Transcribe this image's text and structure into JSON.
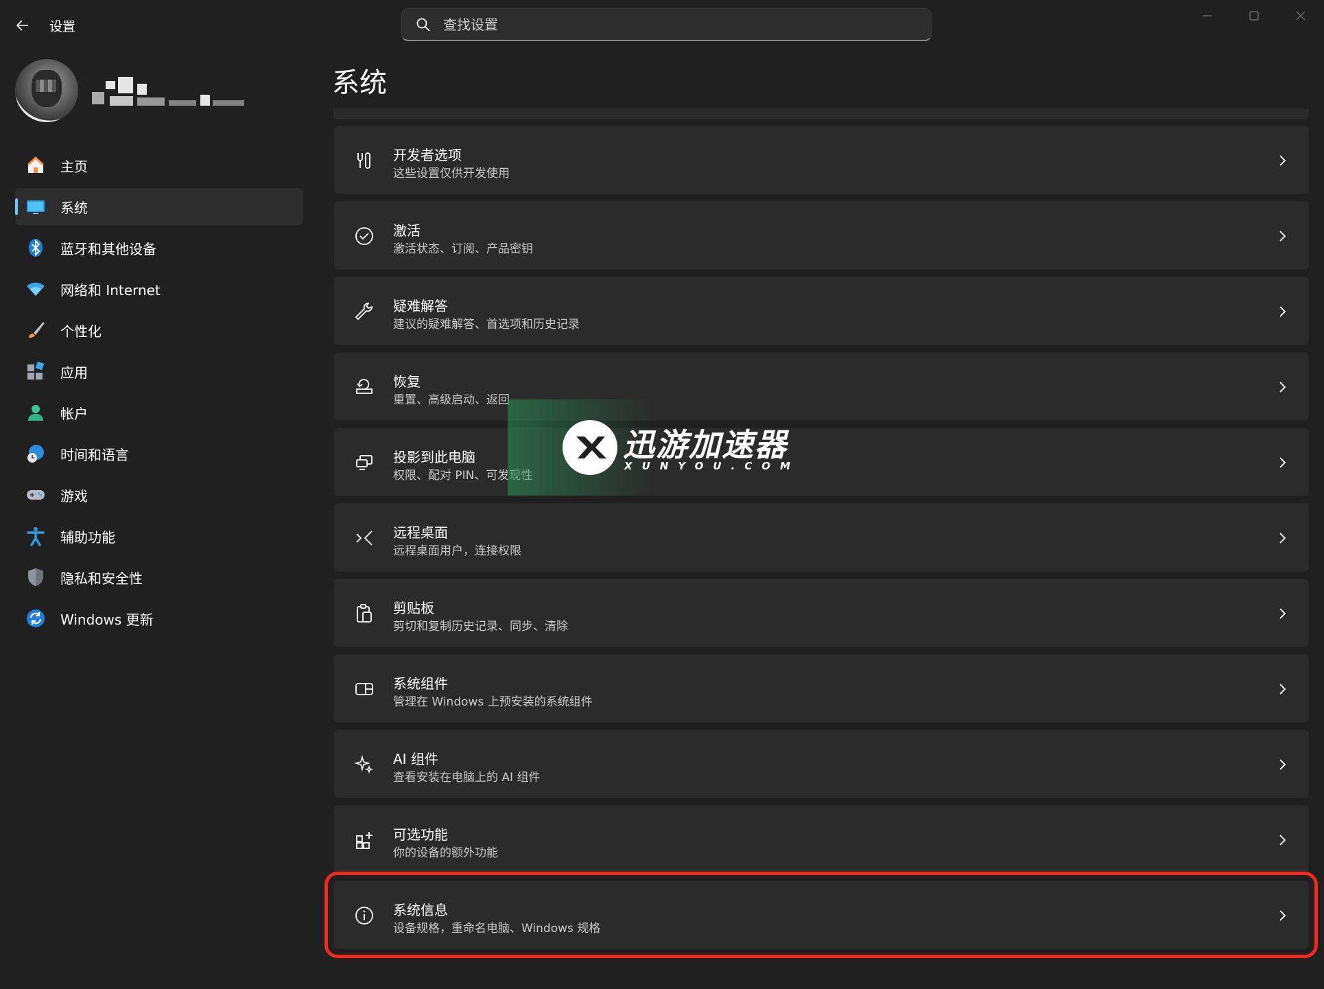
{
  "window": {
    "app_title": "设置",
    "search": {
      "placeholder": "查找设置"
    }
  },
  "sidebar": {
    "items": [
      {
        "label": "主页",
        "icon": "home-icon",
        "selected": false
      },
      {
        "label": "系统",
        "icon": "system-monitor-icon",
        "selected": true
      },
      {
        "label": "蓝牙和其他设备",
        "icon": "bluetooth-icon",
        "selected": false
      },
      {
        "label": "网络和 Internet",
        "icon": "wifi-icon",
        "selected": false
      },
      {
        "label": "个性化",
        "icon": "paintbrush-icon",
        "selected": false
      },
      {
        "label": "应用",
        "icon": "apps-icon",
        "selected": false
      },
      {
        "label": "帐户",
        "icon": "account-icon",
        "selected": false
      },
      {
        "label": "时间和语言",
        "icon": "time-language-icon",
        "selected": false
      },
      {
        "label": "游戏",
        "icon": "gamepad-icon",
        "selected": false
      },
      {
        "label": "辅助功能",
        "icon": "accessibility-icon",
        "selected": false
      },
      {
        "label": "隐私和安全性",
        "icon": "shield-icon",
        "selected": false
      },
      {
        "label": "Windows 更新",
        "icon": "windows-update-icon",
        "selected": false
      }
    ]
  },
  "main": {
    "page_title": "系统",
    "cards": [
      {
        "title": "开发者选项",
        "subtitle": "这些设置仅供开发使用",
        "icon": "developer-tools-icon"
      },
      {
        "title": "激活",
        "subtitle": "激活状态、订阅、产品密钥",
        "icon": "check-circle-icon"
      },
      {
        "title": "疑难解答",
        "subtitle": "建议的疑难解答、首选项和历史记录",
        "icon": "wrench-icon"
      },
      {
        "title": "恢复",
        "subtitle": "重置、高级启动、返回",
        "icon": "recovery-icon"
      },
      {
        "title": "投影到此电脑",
        "subtitle": "权限、配对 PIN、可发现性",
        "icon": "project-to-pc-icon"
      },
      {
        "title": "远程桌面",
        "subtitle": "远程桌面用户，连接权限",
        "icon": "remote-desktop-icon"
      },
      {
        "title": "剪贴板",
        "subtitle": "剪切和复制历史记录、同步、清除",
        "icon": "clipboard-icon"
      },
      {
        "title": "系统组件",
        "subtitle": "管理在 Windows 上预安装的系统组件",
        "icon": "system-components-icon"
      },
      {
        "title": "AI 组件",
        "subtitle": "查看安装在电脑上的 AI 组件",
        "icon": "sparkle-icon"
      },
      {
        "title": "可选功能",
        "subtitle": "你的设备的额外功能",
        "icon": "optional-features-icon"
      },
      {
        "title": "系统信息",
        "subtitle": "设备规格，重命名电脑、Windows 规格",
        "icon": "info-icon",
        "highlighted": true
      }
    ]
  },
  "watermark": {
    "name": "迅游加速器",
    "url": "XUNYOU.COM"
  },
  "colors": {
    "accent": "#60cdff",
    "highlight_box": "#f02b1d",
    "background": "#202020",
    "card": "#2b2b2b"
  }
}
